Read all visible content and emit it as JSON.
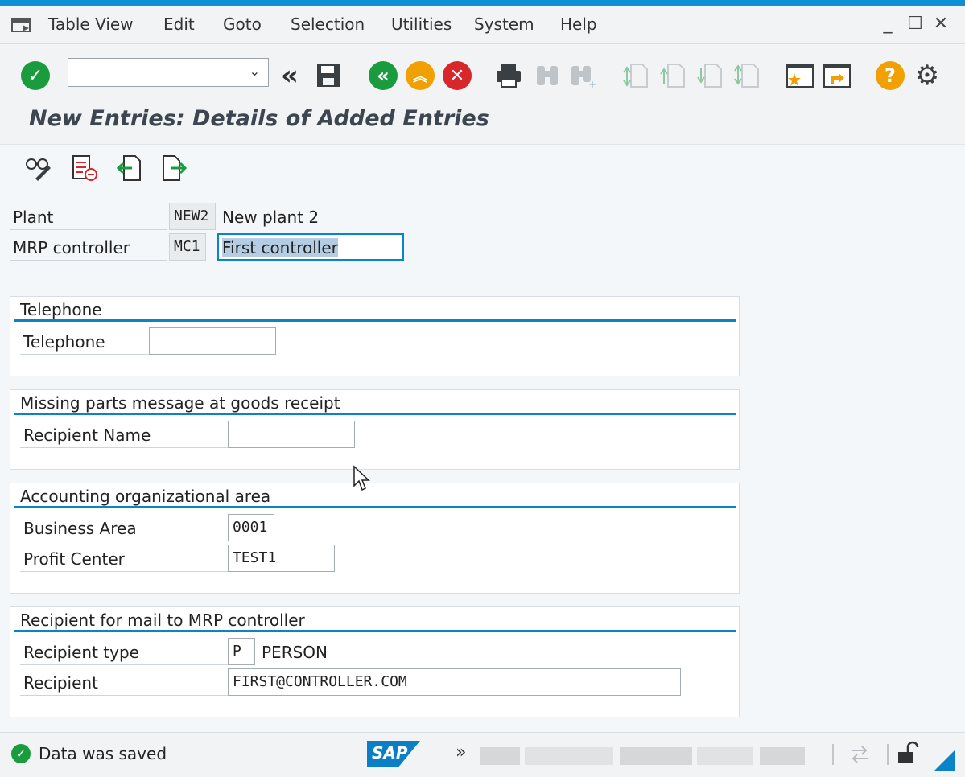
{
  "menu": {
    "items": [
      "Table View",
      "Edit",
      "Goto",
      "Selection",
      "Utilities",
      "System",
      "Help"
    ]
  },
  "window": {
    "minimize": "_",
    "maximize": "☐",
    "close": "✕"
  },
  "toolbar": {
    "command_value": "",
    "icons": [
      "enter-icon",
      "back-double-icon",
      "save-icon",
      "back-icon",
      "exit-icon",
      "cancel-icon",
      "print-icon",
      "find-icon",
      "find-next-icon",
      "first-page-icon",
      "previous-page-icon",
      "next-page-icon",
      "last-page-icon",
      "create-session-icon",
      "shortcut-icon",
      "help-icon",
      "settings-icon"
    ]
  },
  "title": "New Entries: Details of Added Entries",
  "header": {
    "plant_label": "Plant",
    "plant_value": "NEW2",
    "plant_text": "New plant 2",
    "mrp_label": "MRP controller",
    "mrp_value": "MC1",
    "mrp_text": "First controller"
  },
  "groups": {
    "telephone": {
      "title": "Telephone",
      "phone_label": "Telephone",
      "phone_value": ""
    },
    "missing_parts": {
      "title": "Missing parts message at goods receipt",
      "recipient_label": "Recipient Name",
      "recipient_value": ""
    },
    "accounting": {
      "title": "Accounting organizational area",
      "business_area_label": "Business Area",
      "business_area_value": "0001",
      "profit_center_label": "Profit Center",
      "profit_center_value": "TEST1"
    },
    "mail": {
      "title": "Recipient for mail to MRP controller",
      "type_label": "Recipient type",
      "type_value": "P",
      "type_text": "PERSON",
      "recipient_label": "Recipient",
      "recipient_value": "FIRST@CONTROLLER.COM"
    }
  },
  "status": {
    "message": "Data was saved",
    "logo": "SAP",
    "more": "»"
  },
  "colors": {
    "accent": "#0a84c6",
    "green": "#1a9c3e",
    "orange": "#f0a000",
    "red": "#d9262b"
  }
}
